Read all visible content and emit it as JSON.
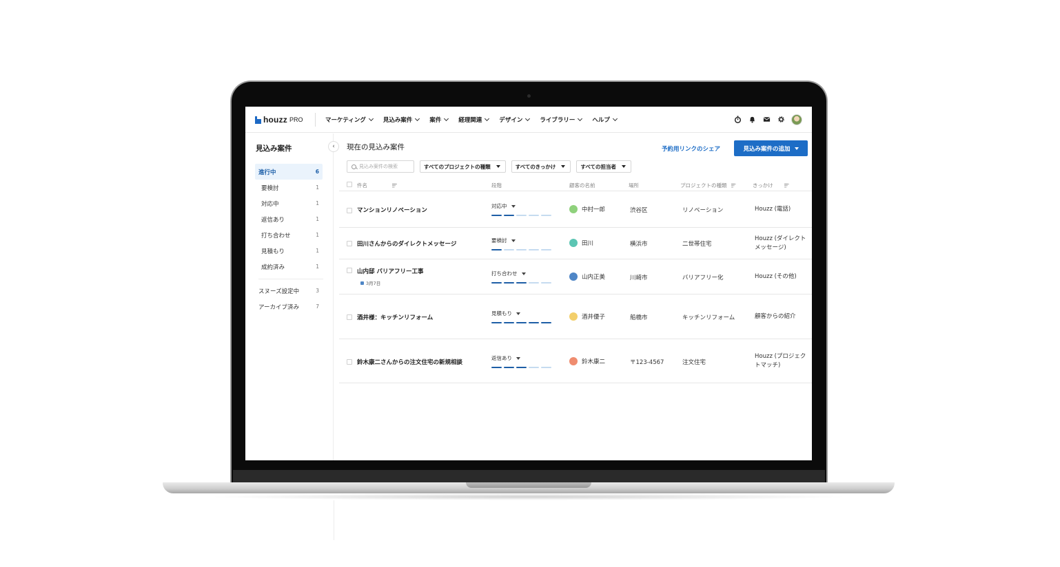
{
  "nav": {
    "logo_text": "houzz",
    "logo_pro": "PRO",
    "menu": [
      {
        "label": "マーケティング"
      },
      {
        "label": "見込み案件"
      },
      {
        "label": "案件"
      },
      {
        "label": "経理関連"
      },
      {
        "label": "デザイン"
      },
      {
        "label": "ライブラリー"
      },
      {
        "label": "ヘルプ"
      }
    ],
    "icons": [
      "timer-icon",
      "bell-icon",
      "mail-icon",
      "gear-icon"
    ]
  },
  "sidebar": {
    "title": "見込み案件",
    "collapse_glyph": "‹",
    "items": [
      {
        "label": "進行中",
        "count": "6"
      },
      {
        "label": "要検討",
        "count": "1"
      },
      {
        "label": "対応中",
        "count": "1"
      },
      {
        "label": "返信あり",
        "count": "1"
      },
      {
        "label": "打ち合わせ",
        "count": "1"
      },
      {
        "label": "見積もり",
        "count": "1"
      },
      {
        "label": "成約済み",
        "count": "1"
      }
    ],
    "lower_items": [
      {
        "label": "スヌーズ設定中",
        "count": "3"
      },
      {
        "label": "アーカイブ済み",
        "count": "7"
      }
    ]
  },
  "main": {
    "title": "現在の見込み案件",
    "share_link": "予約用リンクのシェア",
    "add_button": "見込み案件の追加",
    "search_placeholder": "見込み案件の検索",
    "filters": [
      "すべてのプロジェクトの種類",
      "すべてのきっかけ",
      "すべての担当者"
    ]
  },
  "table": {
    "columns": {
      "title": "件名",
      "stage": "段階",
      "customer": "顧客の名前",
      "location": "場所",
      "project_type": "プロジェクトの種類",
      "origin": "きっかけ"
    },
    "rows": [
      {
        "title": "マンションリノベーション",
        "date": "",
        "stage": "対応中",
        "progress": 2,
        "customer": "中村一郎",
        "avatar_color": "#8fd17c",
        "location": "渋谷区",
        "project_type": "リノベーション",
        "origin": "Houzz (電話)"
      },
      {
        "title": "田川さんからのダイレクトメッセージ",
        "date": "",
        "stage": "要検討",
        "progress": 1,
        "customer": "田川",
        "avatar_color": "#5cc5b3",
        "location": "横浜市",
        "project_type": "二世帯住宅",
        "origin": "Houzz (ダイレクトメッセージ)"
      },
      {
        "title": "山内邸 バリアフリー工事",
        "date": "3月7日",
        "stage": "打ち合わせ",
        "progress": 3,
        "customer": "山内正美",
        "avatar_color": "#4f86c6",
        "location": "川崎市",
        "project_type": "バリアフリー化",
        "origin": "Houzz (その他)"
      },
      {
        "title": "酒井様：キッチンリフォーム",
        "date": "",
        "stage": "見積もり",
        "progress": 5,
        "customer": "酒井優子",
        "avatar_color": "#f3cf6b",
        "location": "船橋市",
        "project_type": "キッチンリフォーム",
        "origin": "顧客からの紹介"
      },
      {
        "title": "鈴木康二さんからの注文住宅の新規相談",
        "date": "",
        "stage": "返信あり",
        "progress": 3,
        "customer": "鈴木康二",
        "avatar_color": "#ef8c6f",
        "location": "〒123-4567",
        "project_type": "注文住宅",
        "origin": "Houzz (プロジェクトマッチ)"
      }
    ]
  }
}
